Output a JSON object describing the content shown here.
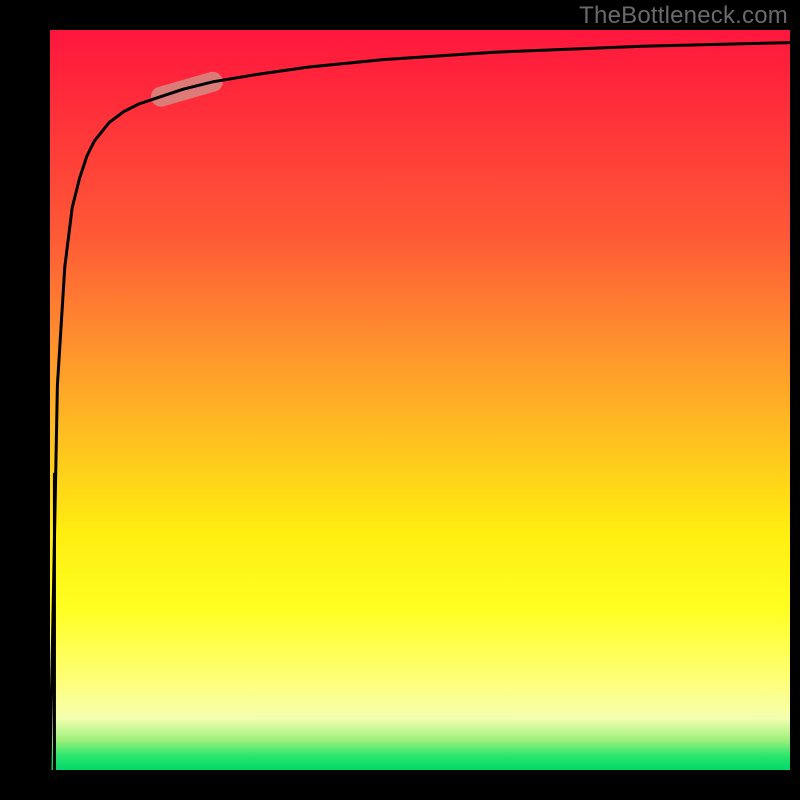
{
  "watermark": "TheBottleneck.com",
  "chart_data": {
    "type": "line",
    "title": "",
    "xlabel": "",
    "ylabel": "",
    "x_range": [
      0,
      100
    ],
    "y_range": [
      0,
      100
    ],
    "grid": false,
    "legend": false,
    "gradient_bands": [
      {
        "name": "red",
        "from_pct": 0,
        "to_pct": 35
      },
      {
        "name": "orange",
        "from_pct": 35,
        "to_pct": 60
      },
      {
        "name": "yellow",
        "from_pct": 60,
        "to_pct": 93
      },
      {
        "name": "green",
        "from_pct": 93,
        "to_pct": 100
      }
    ],
    "colors": {
      "red": "#ff163d",
      "orange": "#ff8f2e",
      "yellow": "#ffff20",
      "green": "#00d968",
      "curve": "#000000",
      "highlight": "#d68a83"
    },
    "series": [
      {
        "name": "bottleneck-curve",
        "x": [
          0,
          1,
          2,
          3,
          4,
          5,
          6,
          8,
          10,
          12,
          15,
          18,
          22,
          28,
          35,
          45,
          60,
          80,
          100
        ],
        "y": [
          0,
          52,
          68,
          76,
          80,
          83,
          85,
          87.5,
          89,
          90,
          91,
          92,
          93,
          94,
          95,
          96,
          97,
          97.8,
          98.3
        ]
      }
    ],
    "highlight_segment": {
      "series": "bottleneck-curve",
      "x_from": 15,
      "x_to": 22,
      "y_from": 91,
      "y_to": 93
    }
  }
}
